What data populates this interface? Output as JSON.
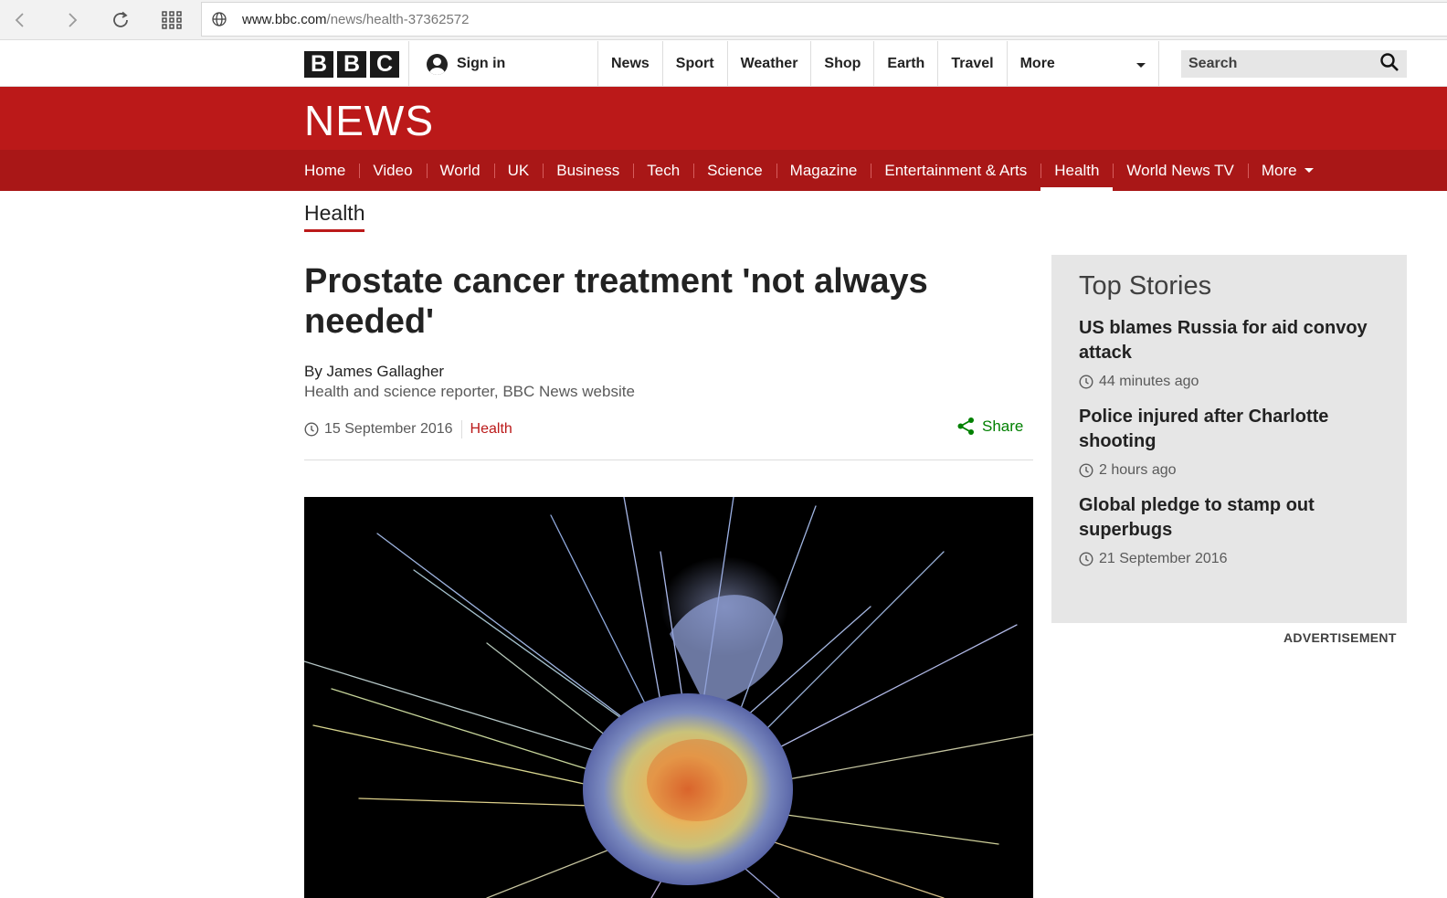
{
  "browser": {
    "url_domain": "www.bbc.com",
    "url_path": "/news/health-37362572"
  },
  "masthead": {
    "logo_letters": [
      "B",
      "B",
      "C"
    ],
    "sign_in": "Sign in",
    "nav": [
      "News",
      "Sport",
      "Weather",
      "Shop",
      "Earth",
      "Travel"
    ],
    "more": "More",
    "search_placeholder": "Search"
  },
  "news_banner": {
    "title": "NEWS",
    "nav": [
      "Home",
      "Video",
      "World",
      "UK",
      "Business",
      "Tech",
      "Science",
      "Magazine",
      "Entertainment & Arts",
      "Health",
      "World News TV"
    ],
    "active": "Health",
    "more": "More"
  },
  "section": {
    "title": "Health"
  },
  "article": {
    "headline": "Prostate cancer treatment 'not always needed'",
    "author": "By James Gallagher",
    "author_role": "Health and science reporter, BBC News website",
    "date": "15 September 2016",
    "category": "Health",
    "share_label": "Share"
  },
  "top_stories": {
    "title": "Top Stories",
    "items": [
      {
        "headline": "US blames Russia for aid convoy attack",
        "time": "44 minutes ago"
      },
      {
        "headline": "Police injured after Charlotte shooting",
        "time": "2 hours ago"
      },
      {
        "headline": "Global pledge to stamp out superbugs",
        "time": "21 September 2016"
      }
    ]
  },
  "advertisement_label": "ADVERTISEMENT",
  "colors": {
    "bbc_red": "#bb1919",
    "nav_red": "#a91717",
    "share_green": "#008000",
    "sidebar_grey": "#e6e6e6"
  }
}
